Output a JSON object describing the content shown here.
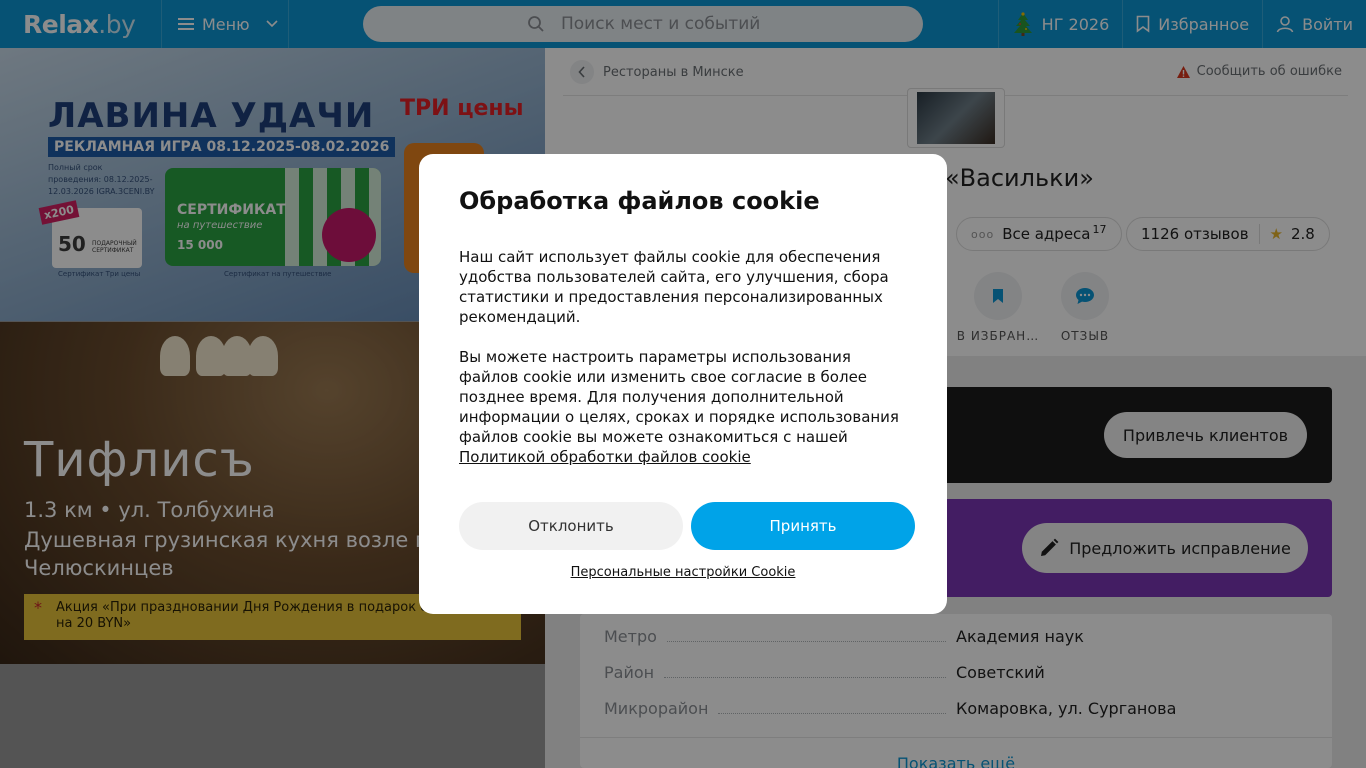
{
  "header": {
    "logo_main": "Relax",
    "logo_suffix": ".by",
    "menu_label": "Меню",
    "search_placeholder": "Поиск мест и событий",
    "ng_label": "НГ 2026",
    "favorites_label": "Избранное",
    "login_label": "Войти"
  },
  "banner": {
    "title": "ЛАВИНА УДАЧИ",
    "subtitle": "РЕКЛАМНАЯ ИГРА 08.12.2025-08.02.2026",
    "terms": "Полный срок проведения: 08.12.2025-12.03.2026 IGRA.3CENI.BY",
    "brand": "ТРИ цены",
    "badge": "x200",
    "card1_value": "50",
    "card1_desc": "ПОДАРОЧНЫЙ СЕРТИФИКАТ",
    "card2_title": "СЕРТИФИКАТ",
    "card2_sub": "на путешествие",
    "card2_value": "15 000",
    "caption1": "Сертификат Три цены",
    "caption2": "Сертификат на путешествие"
  },
  "venue": {
    "title": "Тифлисъ",
    "address": "1.3 км • ул. Толбухина",
    "description": "Душевная грузинская кухня возле п. Челюскинцев",
    "promo": "Акция «При праздновании Дня Рождения в подарок сертификат на 20 BYN»"
  },
  "detail": {
    "breadcrumb": "Рестораны в Минске",
    "report": "Сообщить об ошибке",
    "name": "«Васильки»",
    "all_addresses_label": "Все адреса",
    "all_addresses_count": "17",
    "reviews": "1126 отзывов",
    "rating": "2.8",
    "action_favorite": "В ИЗБРАН…",
    "action_review": "ОТЗЫВ",
    "attract_button": "Привлечь клиентов",
    "suggest_button": "Предложить исправление",
    "info": [
      {
        "key": "Метро",
        "value": "Академия наук"
      },
      {
        "key": "Район",
        "value": "Советский"
      },
      {
        "key": "Микрорайон",
        "value": "Комаровка, ул. Сурганова"
      }
    ],
    "show_more": "Показать ещё"
  },
  "cookie": {
    "title": "Обработка файлов cookie",
    "paragraph1": "Наш сайт использует файлы cookie для обеспечения удобства пользователей сайта, его улучшения, сбора статистики и предоставления персонализированных рекомендаций.",
    "paragraph2": "Вы можете настроить параметры использования файлов cookie или изменить свое согласие в более позднее время. Для получения дополнительной информации о целях, сроках и порядке использования файлов cookie вы можете ознакомиться с нашей",
    "policy_link": "Политикой обработки файлов cookie",
    "decline": "Отклонить",
    "accept": "Принять",
    "settings": "Персональные настройки Cookie"
  },
  "colors": {
    "header_bg": "#0c96d4",
    "accept_bg": "#00a3e8",
    "purple_block": "#7a35b4",
    "promo_bg": "#e8c43a"
  },
  "icons": [
    "menu-icon",
    "chevron-down-icon",
    "search-icon",
    "tree-icon",
    "bookmark-icon",
    "user-icon",
    "back-arrow-icon",
    "warning-icon",
    "star-icon",
    "bookmark-filled-icon",
    "chat-icon",
    "pencil-icon"
  ]
}
